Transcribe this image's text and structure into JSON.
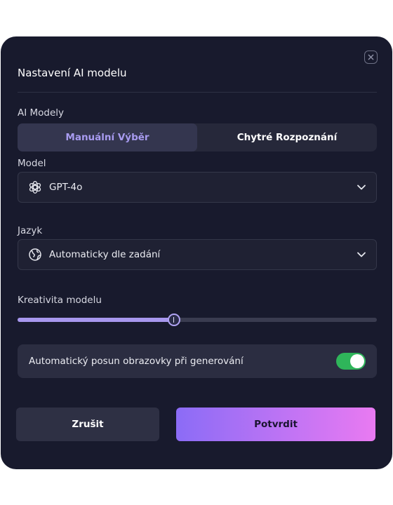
{
  "modal": {
    "title": "Nastavení AI modelu",
    "close_icon": "close-icon"
  },
  "ai_models": {
    "label": "AI Modely",
    "options": [
      {
        "label": "Manuální Výběr",
        "active": true
      },
      {
        "label": "Chytré Rozpoznání",
        "active": false
      }
    ]
  },
  "model": {
    "label": "Model",
    "value": "GPT-4o",
    "icon": "openai-icon"
  },
  "language": {
    "label": "Jazyk",
    "value": "Automaticky dle zadání",
    "icon": "globe-icon"
  },
  "creativity": {
    "label": "Kreativita modelu",
    "value_fraction": 0.435
  },
  "auto_scroll": {
    "label": "Automatický posun obrazovky při generování",
    "enabled": true
  },
  "actions": {
    "cancel_label": "Zrušit",
    "confirm_label": "Potvrdit"
  },
  "colors": {
    "background": "#181a2d",
    "accent": "#a797ee",
    "toggle_on": "#2fb55a",
    "confirm_gradient_start": "#8b6cf6",
    "confirm_gradient_end": "#e97af2"
  }
}
